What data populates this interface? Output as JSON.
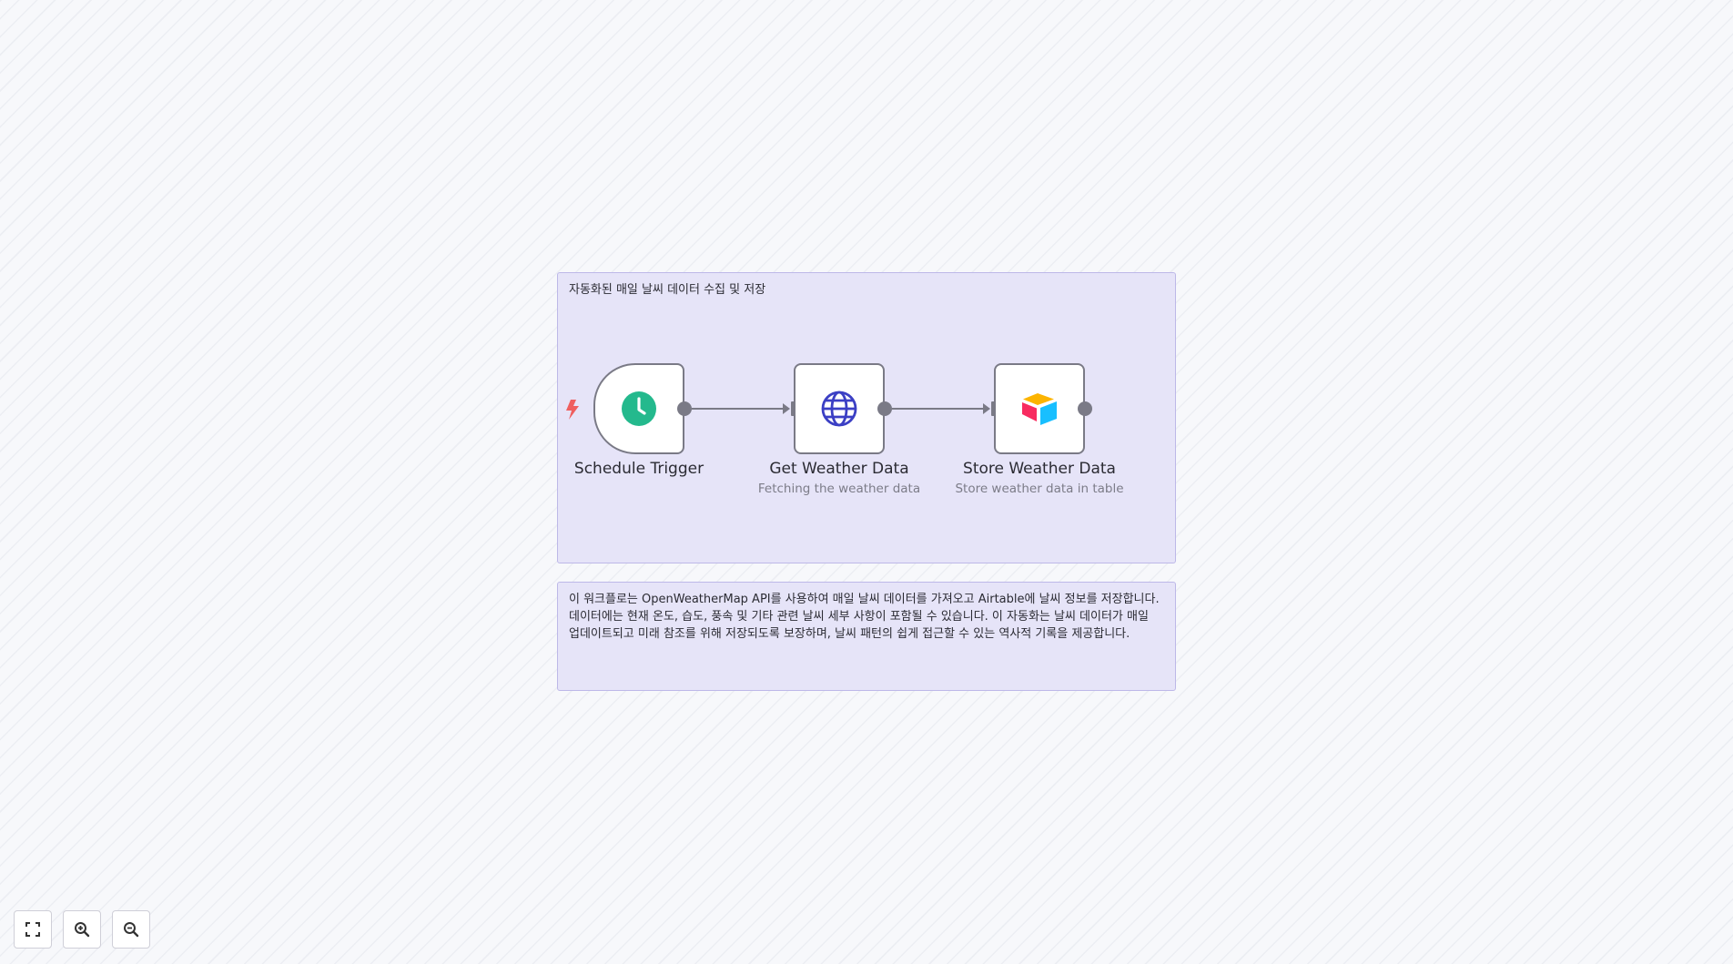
{
  "sticky_main": {
    "title": "자동화된 매일 날씨 데이터 수집 및 저장"
  },
  "sticky_description": {
    "text": "이 워크플로는 OpenWeatherMap API를 사용하여 매일 날씨 데이터를 가져오고 Airtable에 날씨 정보를 저장합니다. 데이터에는 현재 온도, 습도, 풍속 및 기타 관련 날씨 세부 사항이 포함될 수 있습니다. 이 자동화는 날씨 데이터가 매일 업데이트되고 미래 참조를 위해 저장되도록 보장하며, 날씨 패턴의 쉽게 접근할 수 있는 역사적 기록을 제공합니다."
  },
  "nodes": [
    {
      "name": "Schedule Trigger",
      "subtitle": "",
      "icon": "clock-icon",
      "color": "#24b98d"
    },
    {
      "name": "Get Weather Data",
      "subtitle": "Fetching the weather data",
      "icon": "globe-icon",
      "color": "#3b3fc4"
    },
    {
      "name": "Store Weather Data",
      "subtitle": "Store weather data in table",
      "icon": "airtable-icon",
      "color": "#fcb400"
    }
  ],
  "trigger_badge": {
    "icon": "lightning-bolt-icon",
    "color": "#ef5f5f"
  },
  "controls": [
    {
      "icon": "fit-view-icon"
    },
    {
      "icon": "zoom-in-icon"
    },
    {
      "icon": "zoom-out-icon"
    }
  ]
}
